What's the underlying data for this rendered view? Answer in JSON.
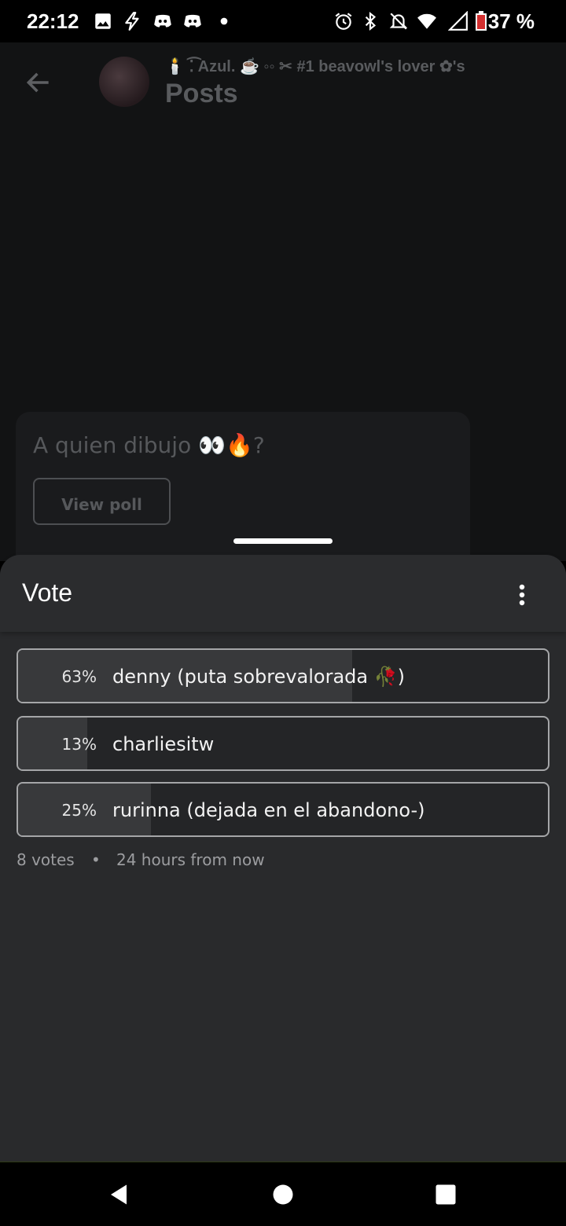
{
  "status_bar": {
    "time": "22:12",
    "battery_percent": "37 %",
    "icons_left": [
      "image-icon",
      "bolt-icon",
      "discord-icon",
      "discord-icon",
      "dot-icon"
    ],
    "icons_right": [
      "alarm-icon",
      "bluetooth-icon",
      "notifications-off-icon",
      "wifi-icon",
      "signal-icon",
      "battery-icon"
    ]
  },
  "app": {
    "subtitle": "🕯️ ⁚͡ Azul. ☕ ◦◦ ✂ #1 beavowl's lover ✿'s",
    "title": "Posts",
    "post": {
      "text": "A quien dibujo 👀🔥?",
      "button": "View poll"
    }
  },
  "sheet": {
    "title": "Vote",
    "options": [
      {
        "percent": "63%",
        "label": "denny (puta sobrevalorada 🥀)",
        "fill": 0.63
      },
      {
        "percent": "13%",
        "label": "charliesitw",
        "fill": 0.13
      },
      {
        "percent": "25%",
        "label": "rurinna (dejada en el abandono-)",
        "fill": 0.25
      }
    ],
    "votes": "8 votes",
    "separator": "•",
    "expires": "24 hours from now"
  },
  "colors": {
    "sheet_bg": "#292a2c",
    "option_border": "#a5a6a8",
    "bar_fill": "#38393b",
    "battery": "#d32f2f"
  }
}
